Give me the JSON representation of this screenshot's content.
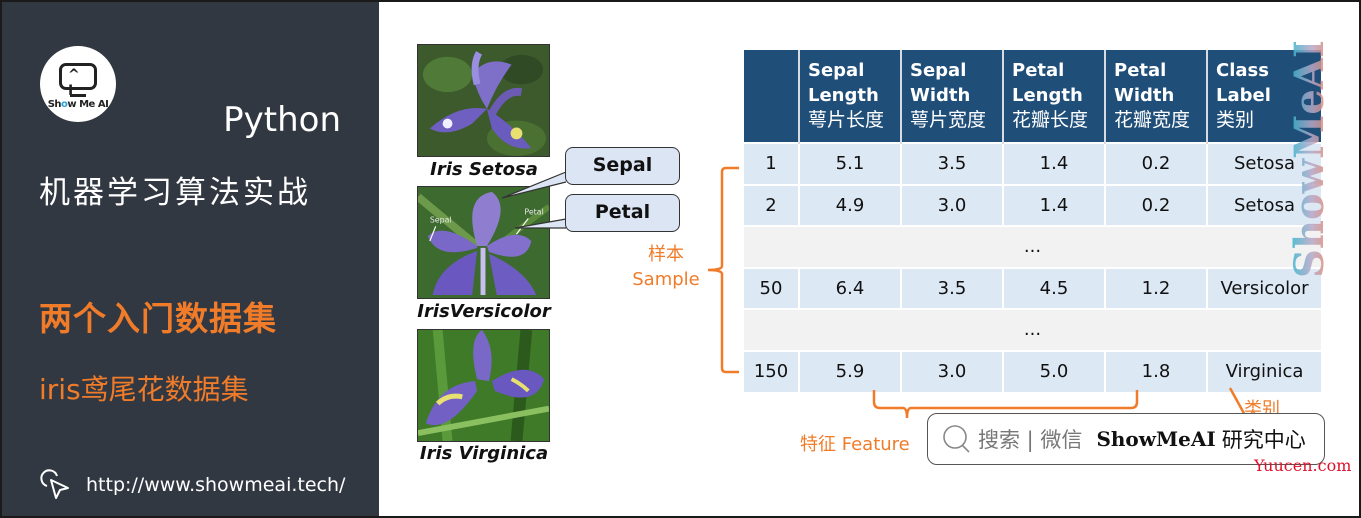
{
  "brand": {
    "logo_text_pre": "Sh",
    "logo_text_o": "o",
    "logo_text_post": "w Me AI",
    "logo_eyes": "^ I"
  },
  "left_panel": {
    "language": "Python",
    "course_title": "机器学习算法实战",
    "section_title": "两个入门数据集",
    "subsection_title": "iris鸢尾花数据集",
    "url": "http://www.showmeai.tech/",
    "colors": {
      "background": "#323842",
      "accent": "#f07c2a"
    }
  },
  "flowers": [
    {
      "caption": "Iris Setosa"
    },
    {
      "caption": "IrisVersicolor",
      "inner_labels": [
        "Sepal",
        "Petal"
      ]
    },
    {
      "caption": "Iris Virginica"
    }
  ],
  "callouts": {
    "sepal": "Sepal",
    "petal": "Petal"
  },
  "annotations": {
    "sample_cn": "样本",
    "sample_en": "Sample",
    "feature": "特征 Feature",
    "class": "类别"
  },
  "table": {
    "headers": [
      {
        "en1": "",
        "en2": "",
        "cn": ""
      },
      {
        "en1": "Sepal",
        "en2": "Length",
        "cn": "萼片长度"
      },
      {
        "en1": "Sepal",
        "en2": "Width",
        "cn": "萼片宽度"
      },
      {
        "en1": "Petal",
        "en2": "Length",
        "cn": "花瓣长度"
      },
      {
        "en1": "Petal",
        "en2": "Width",
        "cn": "花瓣宽度"
      },
      {
        "en1": "Class",
        "en2": "Label",
        "cn": "类别"
      }
    ],
    "rows": [
      {
        "type": "data",
        "cells": [
          "1",
          "5.1",
          "3.5",
          "1.4",
          "0.2",
          "Setosa"
        ]
      },
      {
        "type": "data",
        "cells": [
          "2",
          "4.9",
          "3.0",
          "1.4",
          "0.2",
          "Setosa"
        ]
      },
      {
        "type": "gap",
        "text": "..."
      },
      {
        "type": "data",
        "cells": [
          "50",
          "6.4",
          "3.5",
          "4.5",
          "1.2",
          "Versicolor"
        ]
      },
      {
        "type": "gap",
        "text": "..."
      },
      {
        "type": "data",
        "cells": [
          "150",
          "5.9",
          "3.0",
          "5.0",
          "1.8",
          "Virginica"
        ]
      }
    ],
    "colors": {
      "header": "#1f4e79",
      "row": "#dde8f5",
      "gap": "#f2f2f2"
    }
  },
  "watermark": "ShowMeAI",
  "search_box": {
    "hint": "搜索 | 微信",
    "brand": "ShowMeAI",
    "brand_cn": "研究中心"
  },
  "footer_watermark": "Yuucen.com"
}
